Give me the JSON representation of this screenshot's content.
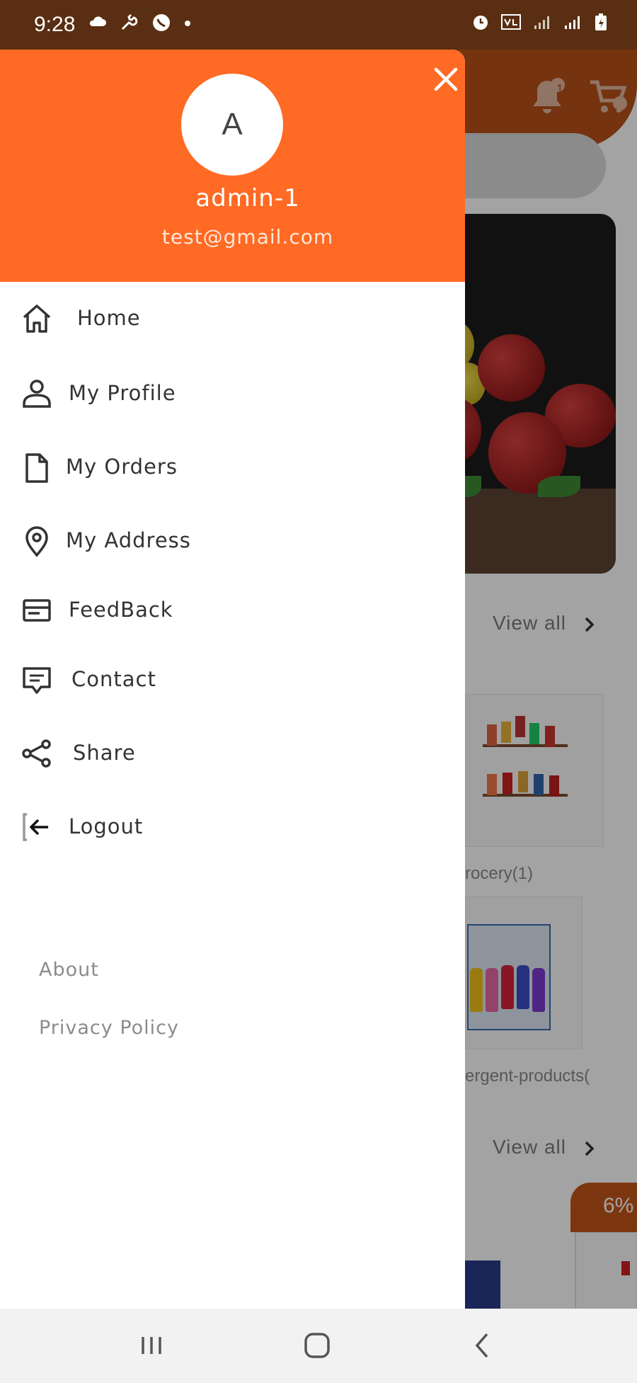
{
  "status_bar": {
    "time": "9:28",
    "left_icons": [
      "cloud-icon",
      "wrench-icon",
      "whatsapp-icon",
      "dot-icon"
    ],
    "right_icons": [
      "alarm-icon",
      "volte-icon",
      "signal-icon",
      "signal-icon",
      "battery-icon"
    ]
  },
  "background_app": {
    "notification_count": "1",
    "cart_count": "1",
    "view_all_label": "View all",
    "categories": [
      "rocery(1)",
      "ergent-products("
    ],
    "discount_badge": "6%"
  },
  "drawer": {
    "avatar_letter": "A",
    "user_name": "admin-1",
    "user_email": "test@gmail.com",
    "menu_items": [
      {
        "label": "Home",
        "icon": "home-icon"
      },
      {
        "label": "My Profile",
        "icon": "user-icon"
      },
      {
        "label": "My Orders",
        "icon": "document-icon"
      },
      {
        "label": "My Address",
        "icon": "location-pin-icon"
      },
      {
        "label": "FeedBack",
        "icon": "feedback-icon"
      },
      {
        "label": "Contact",
        "icon": "chat-icon"
      },
      {
        "label": "Share",
        "icon": "share-icon"
      },
      {
        "label": "Logout",
        "icon": "logout-icon"
      }
    ],
    "footer_links": [
      "About",
      "Privacy Policy"
    ]
  },
  "colors": {
    "drawer_header": "#ff6a24",
    "status_bar": "#5a2e12",
    "overlay": "rgba(0,0,0,0.36)"
  },
  "nav_bar": {
    "buttons": [
      "recent-apps-icon",
      "home-circle-icon",
      "back-icon"
    ]
  }
}
